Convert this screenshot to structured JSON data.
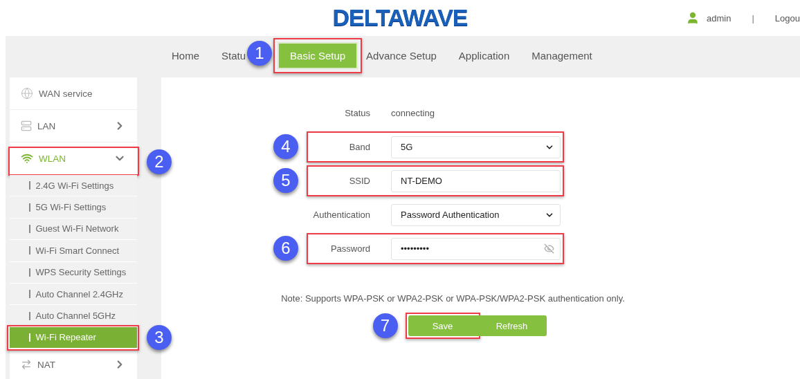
{
  "header": {
    "logo": "DELTAWAVE",
    "user": "admin",
    "separator": "|",
    "logout": "Logou"
  },
  "nav": [
    {
      "label": "Home",
      "selected": false
    },
    {
      "label": "Statu",
      "selected": false
    },
    {
      "label": "Basic Setup",
      "selected": true,
      "step": "1"
    },
    {
      "label": "Advance Setup",
      "selected": false
    },
    {
      "label": "Application",
      "selected": false
    },
    {
      "label": "Management",
      "selected": false
    }
  ],
  "sidebar": [
    {
      "label": "WAN service",
      "kind": "globe",
      "selected": false
    },
    {
      "label": "LAN",
      "kind": "port",
      "selected": false,
      "expanded": false
    },
    {
      "label": "WLAN",
      "kind": "wifi",
      "selected": true,
      "expanded": true,
      "step": "2",
      "children": [
        {
          "label": "2.4G Wi-Fi Settings",
          "selected": false
        },
        {
          "label": "5G Wi-Fi Settings",
          "selected": false
        },
        {
          "label": "Guest Wi-Fi Network",
          "selected": false
        },
        {
          "label": "Wi-Fi Smart Connect",
          "selected": false
        },
        {
          "label": "WPS Security Settings",
          "selected": false
        },
        {
          "label": "Auto Channel 2.4GHz",
          "selected": false
        },
        {
          "label": "Auto Channel 5GHz",
          "selected": false
        },
        {
          "label": "Wi-Fi Repeater",
          "selected": true,
          "step": "3"
        }
      ]
    },
    {
      "label": "NAT",
      "kind": "arrows",
      "selected": false,
      "expanded": false
    }
  ],
  "form": [
    {
      "label": "Status",
      "kind": "text",
      "value": "connecting"
    },
    {
      "label": "Band",
      "kind": "select",
      "value": "5G",
      "step": "4"
    },
    {
      "label": "SSID",
      "kind": "input",
      "value": "NT-DEMO",
      "step": "5"
    },
    {
      "label": "Authentication",
      "kind": "select",
      "value": "Password Authentication"
    },
    {
      "label": "Password",
      "kind": "password",
      "value": "•••••••••",
      "step": "6"
    }
  ],
  "note": "Note: Supports WPA-PSK or WPA2-PSK or WPA-PSK/WPA2-PSK authentication only.",
  "buttons": [
    {
      "label": "Save",
      "step": "7"
    },
    {
      "label": "Refresh"
    }
  ]
}
